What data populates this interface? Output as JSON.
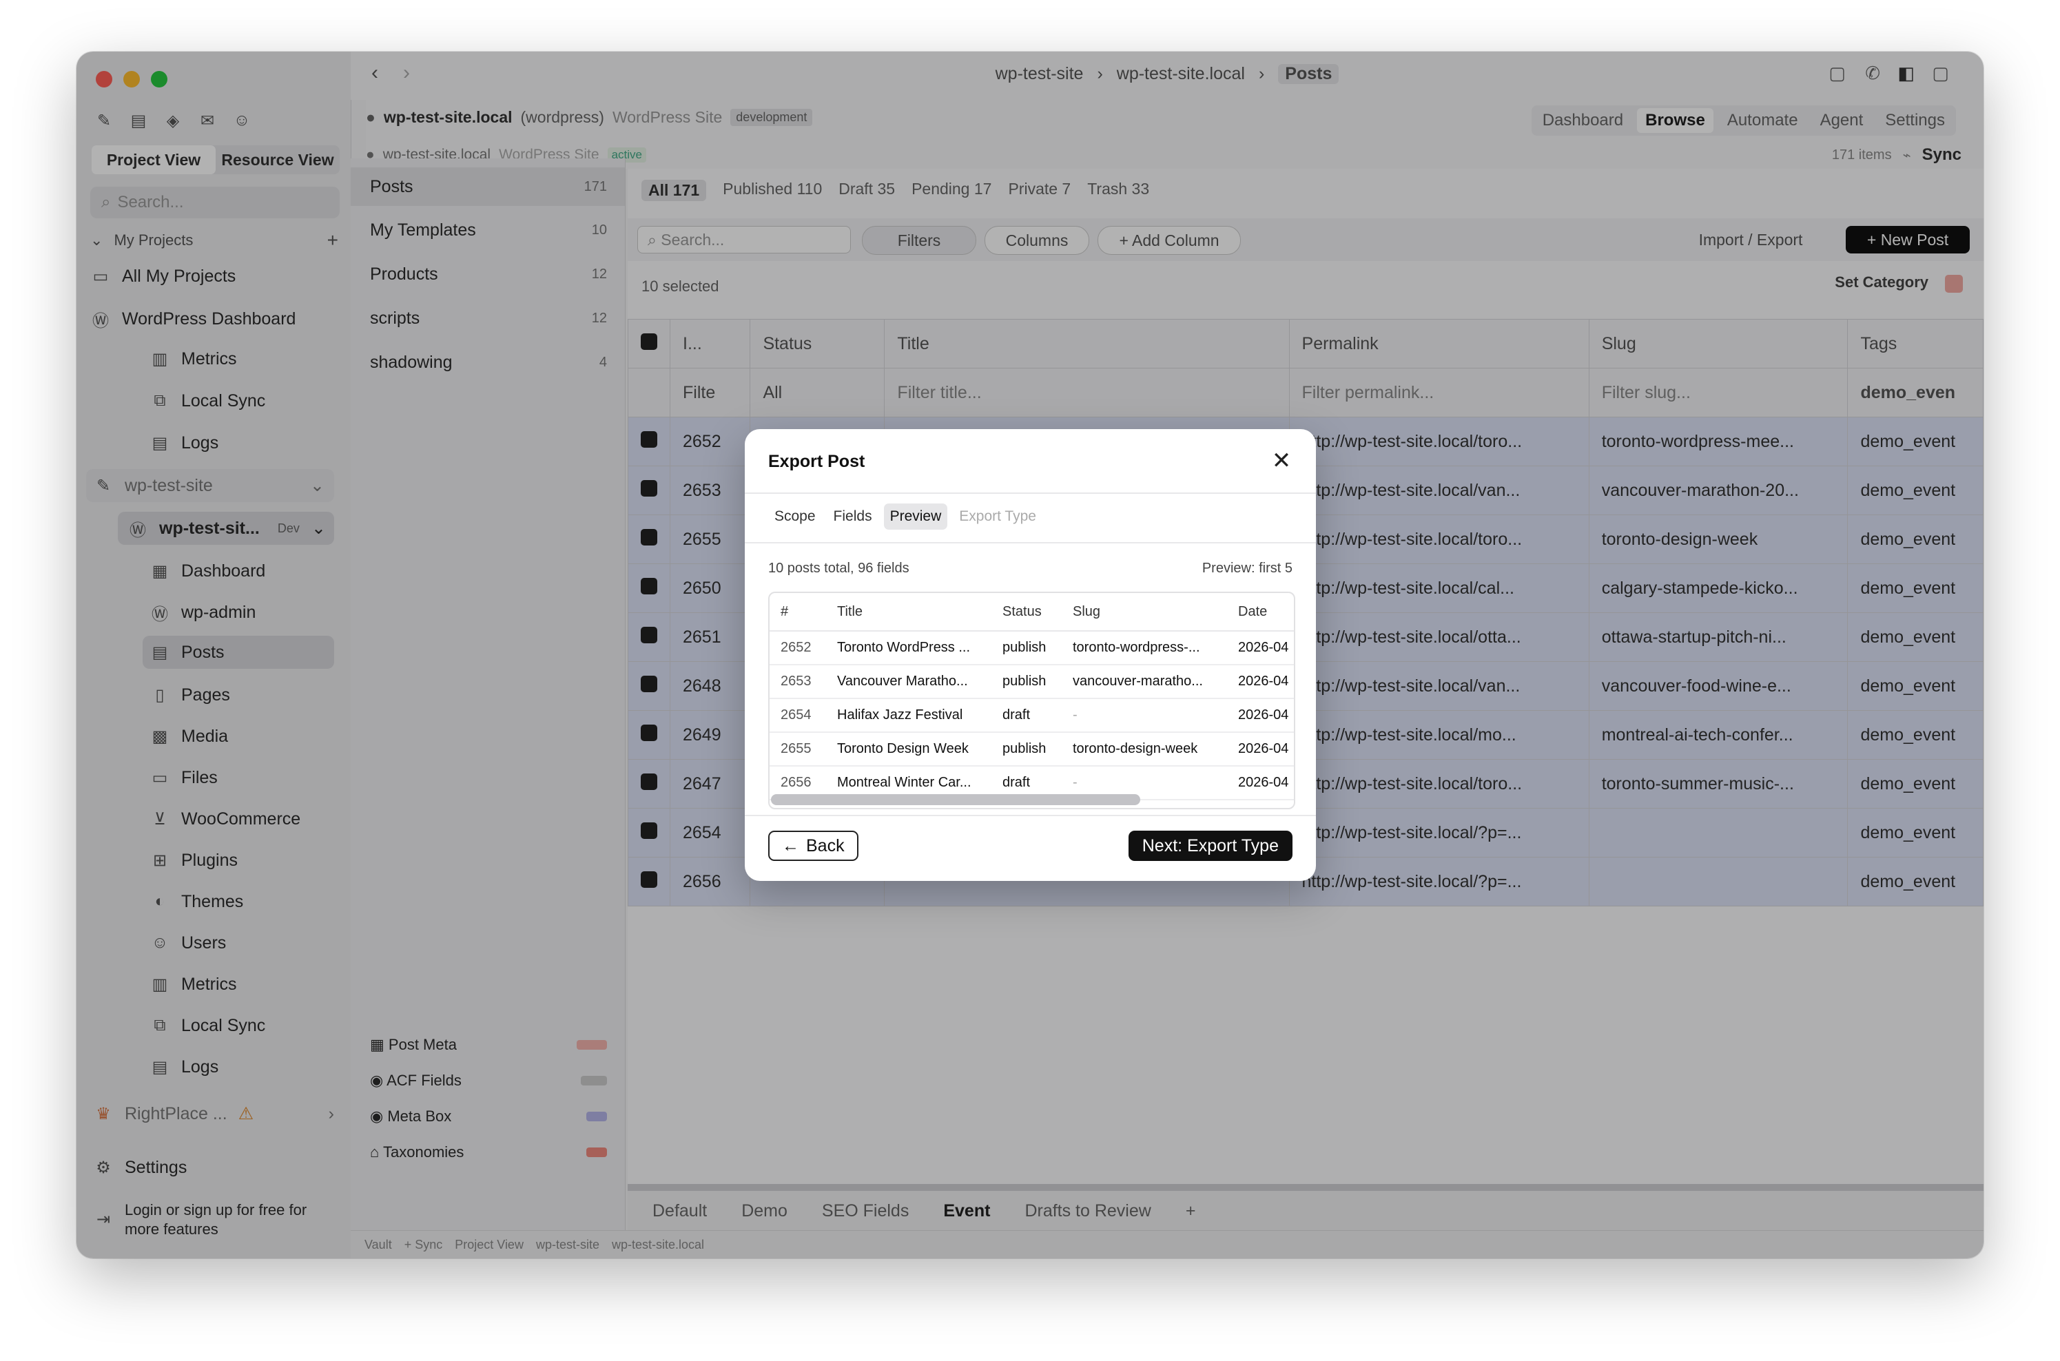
{
  "window": {
    "breadcrumb": [
      "wp-test-site",
      "wp-test-site.local",
      "Posts"
    ],
    "traffic_colors": [
      "#ff5f57",
      "#febc2e",
      "#28c840"
    ]
  },
  "sidebar": {
    "view_tabs": [
      "Project View",
      "Resource View"
    ],
    "search_placeholder": "Search...",
    "section_my_projects": "My Projects",
    "all_my_projects": "All My Projects",
    "wp_dashboard": "WordPress Dashboard",
    "wp_dashboard_children": [
      "Metrics",
      "Local Sync",
      "Logs"
    ],
    "site_group": "wp-test-site",
    "site_item": "wp-test-sit...",
    "site_badge": "Dev",
    "site_children": [
      "Dashboard",
      "wp-admin",
      "Posts",
      "Pages",
      "Media",
      "Files",
      "WooCommerce",
      "Plugins",
      "Themes",
      "Users",
      "Metrics",
      "Local Sync",
      "Logs"
    ],
    "rightplace": "RightPlace ...",
    "settings": "Settings",
    "login_cta": "Login or sign up for free for more features"
  },
  "site_header": {
    "site_name": "wp-test-site.local",
    "site_kind": "(wordpress)",
    "site_desc": "WordPress Site",
    "env_badge": "development",
    "site_line2": "wp-test-site.local",
    "site_line2_desc": "WordPress Site",
    "site_line2_badge": "active",
    "nav": [
      "Dashboard",
      "Browse",
      "Automate",
      "Agent",
      "Settings"
    ],
    "items_count": "171 items",
    "sync": "Sync"
  },
  "post_types": [
    {
      "label": "Posts",
      "count": "171"
    },
    {
      "label": "My Templates",
      "count": "10"
    },
    {
      "label": "Products",
      "count": "12"
    },
    {
      "label": "scripts",
      "count": "12"
    },
    {
      "label": "shadowing",
      "count": "4"
    }
  ],
  "meta_panels": [
    "Post Meta",
    "ACF Fields",
    "Meta Box",
    "Taxonomies"
  ],
  "status_tabs": [
    "All 171",
    "Published 110",
    "Draft 35",
    "Pending 17",
    "Private 7",
    "Trash 33"
  ],
  "toolbar": {
    "search_placeholder": "Search...",
    "filters": "Filters",
    "columns": "Columns",
    "add_column": "+ Add Column",
    "import_export": "Import / Export",
    "new_post": "+ New Post",
    "selected": "10 selected",
    "set_category": "Set Category"
  },
  "grid": {
    "headers": [
      "I...",
      "Status",
      "Title",
      "Permalink",
      "Slug",
      "Tags"
    ],
    "filters": [
      "Filte",
      "All",
      "Filter title...",
      "Filter permalink...",
      "Filter slug...",
      "demo_even"
    ],
    "rows": [
      {
        "id": "2652",
        "permalink": "http://wp-test-site.local/toro...",
        "slug": "toronto-wordpress-mee...",
        "tags": "demo_event"
      },
      {
        "id": "2653",
        "permalink": "http://wp-test-site.local/van...",
        "slug": "vancouver-marathon-20...",
        "tags": "demo_event"
      },
      {
        "id": "2655",
        "permalink": "http://wp-test-site.local/toro...",
        "slug": "toronto-design-week",
        "tags": "demo_event"
      },
      {
        "id": "2650",
        "permalink": "http://wp-test-site.local/cal...",
        "slug": "calgary-stampede-kicko...",
        "tags": "demo_event"
      },
      {
        "id": "2651",
        "permalink": "http://wp-test-site.local/otta...",
        "slug": "ottawa-startup-pitch-ni...",
        "tags": "demo_event"
      },
      {
        "id": "2648",
        "permalink": "http://wp-test-site.local/van...",
        "slug": "vancouver-food-wine-e...",
        "tags": "demo_event"
      },
      {
        "id": "2649",
        "permalink": "http://wp-test-site.local/mo...",
        "slug": "montreal-ai-tech-confer...",
        "tags": "demo_event"
      },
      {
        "id": "2647",
        "permalink": "http://wp-test-site.local/toro...",
        "slug": "toronto-summer-music-...",
        "tags": "demo_event"
      },
      {
        "id": "2654",
        "permalink": "http://wp-test-site.local/?p=...",
        "slug": "",
        "tags": "demo_event"
      },
      {
        "id": "2656",
        "permalink": "http://wp-test-site.local/?p=...",
        "slug": "",
        "tags": "demo_event"
      }
    ]
  },
  "bottom_tabs": [
    "Default",
    "Demo",
    "SEO Fields",
    "Event",
    "Drafts to Review",
    "+"
  ],
  "status_bar": [
    "Vault",
    "+ Sync",
    "Project View",
    "wp-test-site",
    "wp-test-site.local"
  ],
  "modal": {
    "title": "Export Post",
    "tabs": [
      "Scope",
      "Fields",
      "Preview",
      "Export Type"
    ],
    "summary": "10 posts total, 96 fields",
    "preview_note": "Preview: first 5",
    "columns": [
      "#",
      "Title",
      "Status",
      "Slug",
      "Date"
    ],
    "rows": [
      {
        "id": "2652",
        "title": "Toronto WordPress ...",
        "status": "publish",
        "slug": "toronto-wordpress-...",
        "date": "2026-04"
      },
      {
        "id": "2653",
        "title": "Vancouver Maratho...",
        "status": "publish",
        "slug": "vancouver-maratho...",
        "date": "2026-04"
      },
      {
        "id": "2654",
        "title": "Halifax Jazz Festival",
        "status": "draft",
        "slug": "-",
        "date": "2026-04"
      },
      {
        "id": "2655",
        "title": "Toronto Design Week",
        "status": "publish",
        "slug": "toronto-design-week",
        "date": "2026-04"
      },
      {
        "id": "2656",
        "title": "Montreal Winter Car...",
        "status": "draft",
        "slug": "-",
        "date": "2026-04"
      }
    ],
    "back": "Back",
    "next": "Next: Export Type"
  }
}
